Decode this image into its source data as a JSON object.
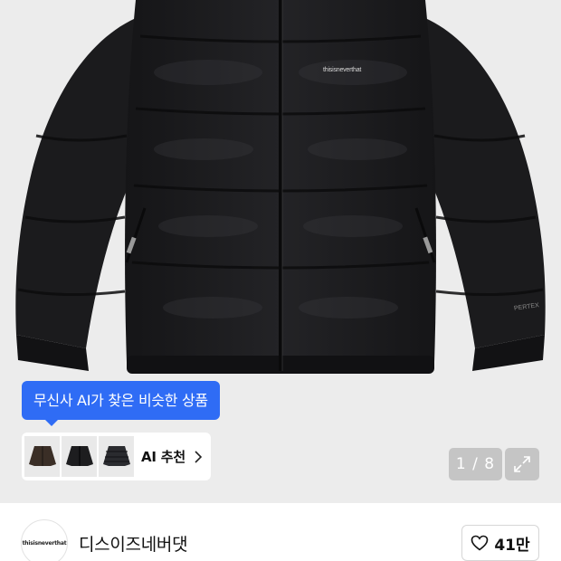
{
  "product_image": {
    "jacket_print": "thisisneverthat",
    "tag_text": "PERTEX"
  },
  "ai_recommend": {
    "tooltip": "무신사 AI가 찾은 비슷한 상품",
    "label": "AI 추천"
  },
  "gallery": {
    "counter": "1 / 8"
  },
  "brand": {
    "logo_text": "thisisneverthat",
    "name": "디스이즈네버댓"
  },
  "like": {
    "count": "41만"
  },
  "icons": {
    "chevron": "chevron-right-icon",
    "expand": "expand-icon",
    "heart": "heart-icon"
  },
  "colors": {
    "tooltip_bg": "#2f6cf5",
    "jacket": "#1c1c1e",
    "background": "#ececec"
  }
}
